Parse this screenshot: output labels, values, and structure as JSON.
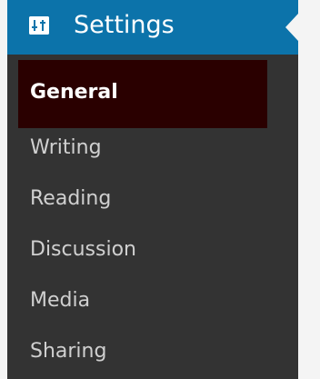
{
  "header": {
    "title": "Settings",
    "icon": "settings-sliders-icon"
  },
  "colors": {
    "header_bg": "#0c73aa",
    "menu_bg": "#333333",
    "active_bg": "#2a0000",
    "active_text": "#ffffff",
    "item_text": "#d0d0d0"
  },
  "submenu": {
    "items": [
      {
        "label": "General",
        "active": true
      },
      {
        "label": "Writing",
        "active": false
      },
      {
        "label": "Reading",
        "active": false
      },
      {
        "label": "Discussion",
        "active": false
      },
      {
        "label": "Media",
        "active": false
      },
      {
        "label": "Sharing",
        "active": false
      }
    ]
  }
}
